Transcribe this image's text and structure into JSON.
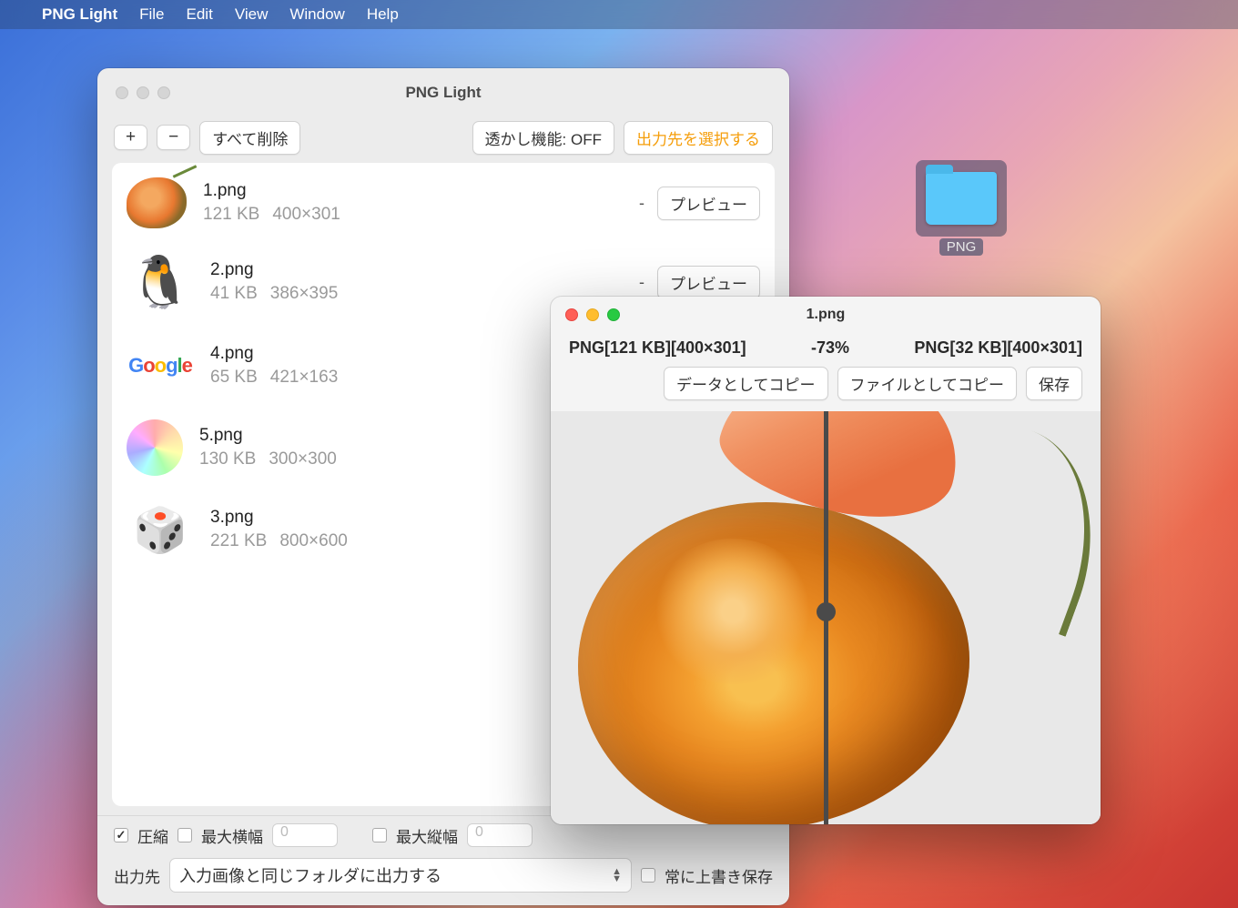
{
  "menubar": {
    "appname": "PNG Light",
    "items": [
      "File",
      "Edit",
      "View",
      "Window",
      "Help"
    ]
  },
  "desktop": {
    "folder_label": "PNG"
  },
  "main_window": {
    "title": "PNG Light",
    "toolbar": {
      "add": "+",
      "remove": "−",
      "clear_all": "すべて削除",
      "watermark": "透かし機能: OFF",
      "choose_output": "出力先を選択する"
    },
    "files": [
      {
        "name": "1.png",
        "size": "121 KB",
        "dims": "400×301",
        "status": "-",
        "preview": "プレビュー",
        "thumb": "rose"
      },
      {
        "name": "2.png",
        "size": "41 KB",
        "dims": "386×395",
        "status": "-",
        "preview": "プレビュー",
        "thumb": "tux"
      },
      {
        "name": "4.png",
        "size": "65 KB",
        "dims": "421×163",
        "status": "",
        "preview": "",
        "thumb": "google"
      },
      {
        "name": "5.png",
        "size": "130 KB",
        "dims": "300×300",
        "status": "",
        "preview": "",
        "thumb": "wheel"
      },
      {
        "name": "3.png",
        "size": "221 KB",
        "dims": "800×600",
        "status": "",
        "preview": "",
        "thumb": "dice"
      }
    ],
    "options": {
      "compress_label": "圧縮",
      "max_width_label": "最大横幅",
      "max_width_value": "0",
      "max_height_label": "最大縦幅",
      "max_height_value": "0",
      "output_label": "出力先",
      "output_select": "入力画像と同じフォルダに出力する",
      "overwrite_label": "常に上書き保存"
    }
  },
  "preview_window": {
    "title": "1.png",
    "left_info": "PNG[121 KB][400×301]",
    "percent": "-73%",
    "right_info": "PNG[32 KB][400×301]",
    "copy_data": "データとしてコピー",
    "copy_file": "ファイルとしてコピー",
    "save": "保存"
  }
}
